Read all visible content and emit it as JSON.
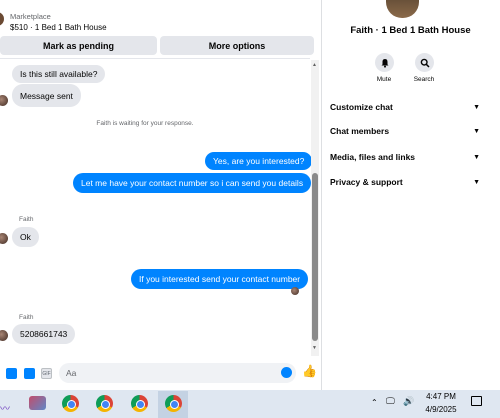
{
  "listing": {
    "source": "Marketplace",
    "title": "$510 · 1 Bed 1 Bath House"
  },
  "actions": {
    "mark_pending": "Mark as pending",
    "more_options": "More options"
  },
  "messages": {
    "m1": "Is this still available?",
    "m2": "Message sent",
    "system_note": "Faith is waiting for your response.",
    "m3": "Yes, are you interested?",
    "m4": "Let me have your contact number so i can send you details",
    "sender_1": "Faith",
    "m5": "Ok",
    "m6": "If you interested send your contact number",
    "sender_2": "Faith",
    "m7": "5208661743"
  },
  "composer": {
    "placeholder": "Aa",
    "gif_label": "GIF"
  },
  "info": {
    "title": "Faith · 1 Bed 1 Bath House",
    "mute_label": "Mute",
    "search_label": "Search",
    "sections": [
      "Customize chat",
      "Chat members",
      "Media, files and links",
      "Privacy & support"
    ]
  },
  "taskbar": {
    "time": "4:47 PM",
    "date": "4/9/2025"
  },
  "colors": {
    "outgoing": "#0084ff",
    "incoming": "#e4e6eb"
  }
}
